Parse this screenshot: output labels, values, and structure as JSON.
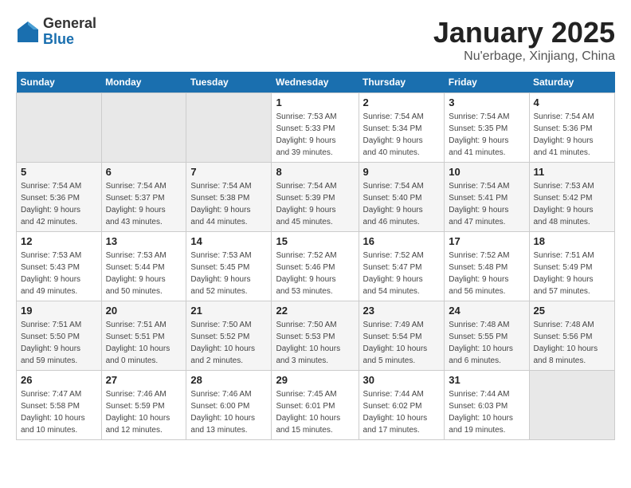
{
  "logo": {
    "general": "General",
    "blue": "Blue"
  },
  "title": "January 2025",
  "subtitle": "Nu'erbage, Xinjiang, China",
  "days_of_week": [
    "Sunday",
    "Monday",
    "Tuesday",
    "Wednesday",
    "Thursday",
    "Friday",
    "Saturday"
  ],
  "weeks": [
    [
      {
        "num": "",
        "info": ""
      },
      {
        "num": "",
        "info": ""
      },
      {
        "num": "",
        "info": ""
      },
      {
        "num": "1",
        "info": "Sunrise: 7:53 AM\nSunset: 5:33 PM\nDaylight: 9 hours\nand 39 minutes."
      },
      {
        "num": "2",
        "info": "Sunrise: 7:54 AM\nSunset: 5:34 PM\nDaylight: 9 hours\nand 40 minutes."
      },
      {
        "num": "3",
        "info": "Sunrise: 7:54 AM\nSunset: 5:35 PM\nDaylight: 9 hours\nand 41 minutes."
      },
      {
        "num": "4",
        "info": "Sunrise: 7:54 AM\nSunset: 5:36 PM\nDaylight: 9 hours\nand 41 minutes."
      }
    ],
    [
      {
        "num": "5",
        "info": "Sunrise: 7:54 AM\nSunset: 5:36 PM\nDaylight: 9 hours\nand 42 minutes."
      },
      {
        "num": "6",
        "info": "Sunrise: 7:54 AM\nSunset: 5:37 PM\nDaylight: 9 hours\nand 43 minutes."
      },
      {
        "num": "7",
        "info": "Sunrise: 7:54 AM\nSunset: 5:38 PM\nDaylight: 9 hours\nand 44 minutes."
      },
      {
        "num": "8",
        "info": "Sunrise: 7:54 AM\nSunset: 5:39 PM\nDaylight: 9 hours\nand 45 minutes."
      },
      {
        "num": "9",
        "info": "Sunrise: 7:54 AM\nSunset: 5:40 PM\nDaylight: 9 hours\nand 46 minutes."
      },
      {
        "num": "10",
        "info": "Sunrise: 7:54 AM\nSunset: 5:41 PM\nDaylight: 9 hours\nand 47 minutes."
      },
      {
        "num": "11",
        "info": "Sunrise: 7:53 AM\nSunset: 5:42 PM\nDaylight: 9 hours\nand 48 minutes."
      }
    ],
    [
      {
        "num": "12",
        "info": "Sunrise: 7:53 AM\nSunset: 5:43 PM\nDaylight: 9 hours\nand 49 minutes."
      },
      {
        "num": "13",
        "info": "Sunrise: 7:53 AM\nSunset: 5:44 PM\nDaylight: 9 hours\nand 50 minutes."
      },
      {
        "num": "14",
        "info": "Sunrise: 7:53 AM\nSunset: 5:45 PM\nDaylight: 9 hours\nand 52 minutes."
      },
      {
        "num": "15",
        "info": "Sunrise: 7:52 AM\nSunset: 5:46 PM\nDaylight: 9 hours\nand 53 minutes."
      },
      {
        "num": "16",
        "info": "Sunrise: 7:52 AM\nSunset: 5:47 PM\nDaylight: 9 hours\nand 54 minutes."
      },
      {
        "num": "17",
        "info": "Sunrise: 7:52 AM\nSunset: 5:48 PM\nDaylight: 9 hours\nand 56 minutes."
      },
      {
        "num": "18",
        "info": "Sunrise: 7:51 AM\nSunset: 5:49 PM\nDaylight: 9 hours\nand 57 minutes."
      }
    ],
    [
      {
        "num": "19",
        "info": "Sunrise: 7:51 AM\nSunset: 5:50 PM\nDaylight: 9 hours\nand 59 minutes."
      },
      {
        "num": "20",
        "info": "Sunrise: 7:51 AM\nSunset: 5:51 PM\nDaylight: 10 hours\nand 0 minutes."
      },
      {
        "num": "21",
        "info": "Sunrise: 7:50 AM\nSunset: 5:52 PM\nDaylight: 10 hours\nand 2 minutes."
      },
      {
        "num": "22",
        "info": "Sunrise: 7:50 AM\nSunset: 5:53 PM\nDaylight: 10 hours\nand 3 minutes."
      },
      {
        "num": "23",
        "info": "Sunrise: 7:49 AM\nSunset: 5:54 PM\nDaylight: 10 hours\nand 5 minutes."
      },
      {
        "num": "24",
        "info": "Sunrise: 7:48 AM\nSunset: 5:55 PM\nDaylight: 10 hours\nand 6 minutes."
      },
      {
        "num": "25",
        "info": "Sunrise: 7:48 AM\nSunset: 5:56 PM\nDaylight: 10 hours\nand 8 minutes."
      }
    ],
    [
      {
        "num": "26",
        "info": "Sunrise: 7:47 AM\nSunset: 5:58 PM\nDaylight: 10 hours\nand 10 minutes."
      },
      {
        "num": "27",
        "info": "Sunrise: 7:46 AM\nSunset: 5:59 PM\nDaylight: 10 hours\nand 12 minutes."
      },
      {
        "num": "28",
        "info": "Sunrise: 7:46 AM\nSunset: 6:00 PM\nDaylight: 10 hours\nand 13 minutes."
      },
      {
        "num": "29",
        "info": "Sunrise: 7:45 AM\nSunset: 6:01 PM\nDaylight: 10 hours\nand 15 minutes."
      },
      {
        "num": "30",
        "info": "Sunrise: 7:44 AM\nSunset: 6:02 PM\nDaylight: 10 hours\nand 17 minutes."
      },
      {
        "num": "31",
        "info": "Sunrise: 7:44 AM\nSunset: 6:03 PM\nDaylight: 10 hours\nand 19 minutes."
      },
      {
        "num": "",
        "info": ""
      }
    ]
  ]
}
